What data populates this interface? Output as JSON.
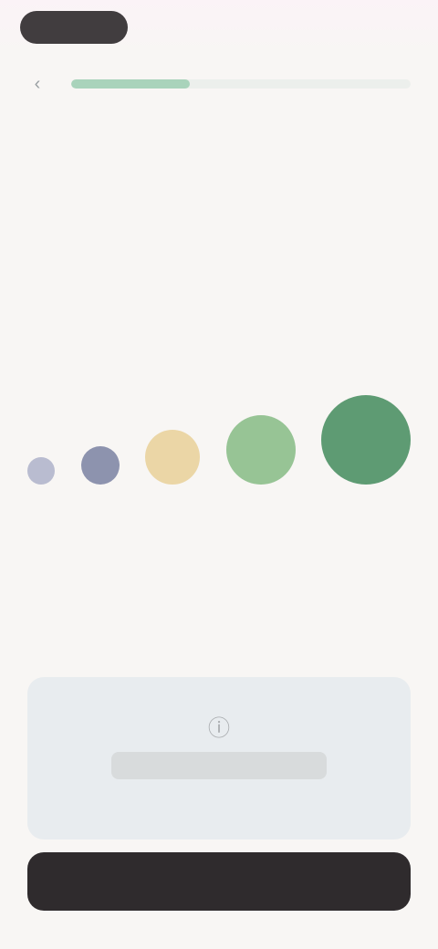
{
  "header": {
    "pill_label": "",
    "back_icon": "chevron-left-icon",
    "progress_percent": 35
  },
  "question": {
    "title": "",
    "subtitle": ""
  },
  "scale": {
    "options": [
      {
        "label": "",
        "color": "#b9bcd0"
      },
      {
        "label": "",
        "color": "#8d93ae"
      },
      {
        "label": "",
        "color": "#ebd6a6"
      },
      {
        "label": "",
        "color": "#97c495"
      },
      {
        "label": "",
        "color": "#5e9b73"
      }
    ]
  },
  "info_card": {
    "icon": "info-icon",
    "text": ""
  },
  "cta": {
    "label": ""
  },
  "colors": {
    "accent_green": "#5e9b73",
    "progress_fill": "#a9d3bb",
    "cta_background": "#2f2b2d"
  }
}
